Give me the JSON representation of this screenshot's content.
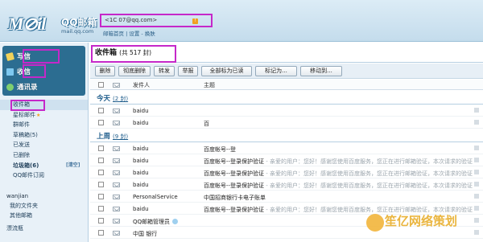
{
  "header": {
    "logo_mark": "M⊘il",
    "logo_name": "QQ邮箱",
    "logo_domain": "mail.qq.com",
    "account_email": "<1C          07@qq.com>",
    "account_links": "邮箱首页 | 设置 - 换肤"
  },
  "sidebar": {
    "quick": {
      "write": "写信",
      "receive": "收信",
      "contacts": "通讯录"
    },
    "folders": [
      {
        "label": "收件箱"
      },
      {
        "label": "星标邮件"
      },
      {
        "label": "群邮件"
      },
      {
        "label": "草稿箱(5)"
      },
      {
        "label": "已发送"
      },
      {
        "label": "已删除"
      },
      {
        "label": "垃圾箱(6)",
        "action": "[清空]"
      },
      {
        "label": "QQ邮件订阅"
      }
    ],
    "other_header": "wanjian",
    "others": [
      "我的文件夹",
      "其他邮箱"
    ],
    "others_tail": "漂流瓶"
  },
  "main": {
    "title": "收件箱",
    "count": "(共 517 封)",
    "toolbar": [
      "删除",
      "彻底删除",
      "转发",
      "举报",
      "全部标为已读",
      "标记为...",
      "移动到..."
    ],
    "columns": {
      "sender": "发件人",
      "subject": "主题"
    },
    "groups": [
      {
        "title": "今天",
        "count": "(2 封)",
        "rows": [
          {
            "sender": "baidu",
            "subject": "",
            "preview": ""
          },
          {
            "sender": "baidu",
            "subject": "百",
            "preview": ""
          }
        ]
      },
      {
        "title": "上周",
        "count": "(9 封)",
        "rows": [
          {
            "sender": "baidu",
            "subject": "百度帐号--登",
            "preview": ""
          },
          {
            "sender": "baidu",
            "subject": "百度帐号--登录保护验证",
            "preview": " - 亲爱的用户：您好！感谢您使用百度服务，您正在进行邮箱验证，本次请求的验证"
          },
          {
            "sender": "baidu",
            "subject": "百度帐号--登录保护验证",
            "preview": " - 亲爱的用户：您好！感谢您使用百度服务，您正在进行邮箱验证，本次请求的验证"
          },
          {
            "sender": "baidu",
            "subject": "百度帐号--登录保护验证",
            "preview": " - 亲爱的用户：您好！感谢您使用百度服务，您正在进行邮箱验证，本次请求的验证"
          },
          {
            "sender": "PersonalService",
            "subject": "中国招商银行卡电子账单",
            "preview": ""
          },
          {
            "sender": "baidu",
            "subject": "百度帐号--登录保护验证",
            "preview": " - 亲爱的用户：您好！感谢您使用百度服务，您正在进行邮箱验证，本次请求的验证"
          },
          {
            "sender": "QQ邮箱管理员",
            "subject": "",
            "preview": ""
          },
          {
            "sender": "中国   银行",
            "subject": "",
            "preview": ""
          }
        ]
      }
    ]
  },
  "watermark": "笙亿网络策划"
}
